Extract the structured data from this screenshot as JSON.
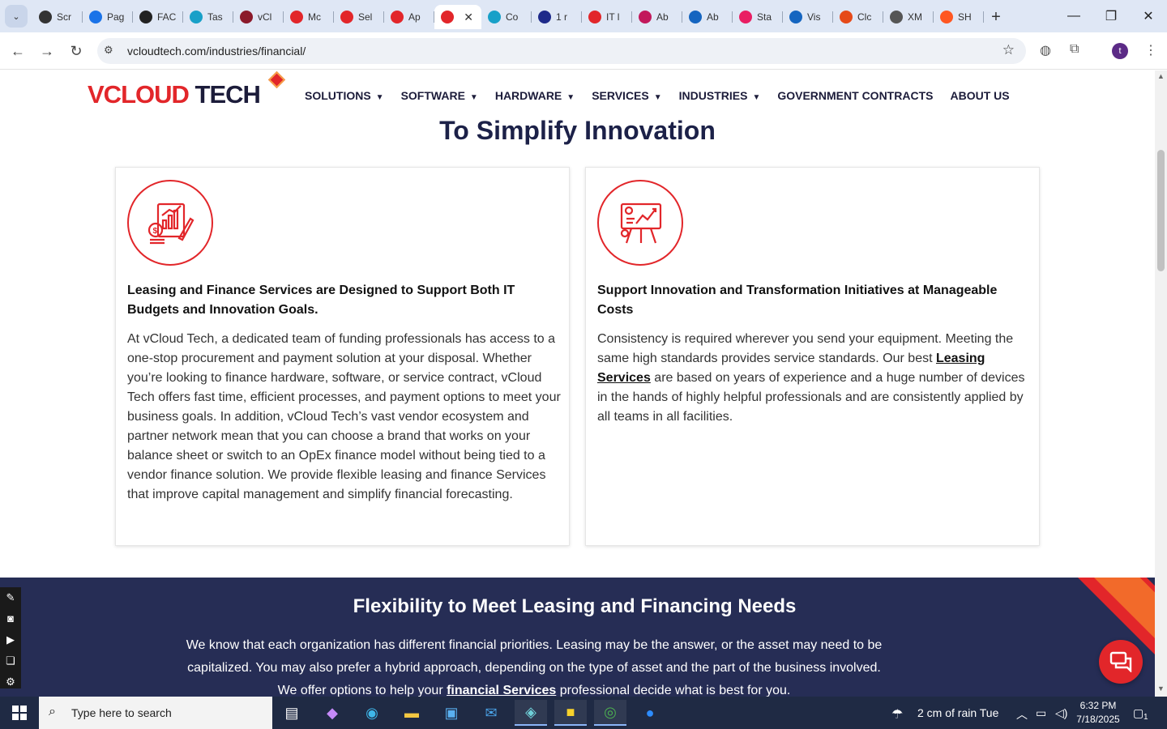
{
  "browser": {
    "tabs": [
      {
        "label": "Scr",
        "color": "#333333"
      },
      {
        "label": "Pag",
        "color": "#1a73e8"
      },
      {
        "label": "FAC",
        "color": "#222222"
      },
      {
        "label": "Tas",
        "color": "#18a0c8"
      },
      {
        "label": "vCl",
        "color": "#8b1a2b"
      },
      {
        "label": "Mc",
        "color": "#e2262a"
      },
      {
        "label": "Sel",
        "color": "#e2262a"
      },
      {
        "label": "Ap",
        "color": "#e2262a"
      },
      {
        "label": "",
        "color": "#e2262a"
      },
      {
        "label": "Co",
        "color": "#18a0c8"
      },
      {
        "label": "1 r",
        "color": "#1e2a8a"
      },
      {
        "label": "IT l",
        "color": "#e2262a"
      },
      {
        "label": "Ab",
        "color": "#c2185b"
      },
      {
        "label": "Ab",
        "color": "#1565c0"
      },
      {
        "label": "Sta",
        "color": "#e91e63"
      },
      {
        "label": "Vis",
        "color": "#1565c0"
      },
      {
        "label": "Clc",
        "color": "#e64a19"
      },
      {
        "label": "XM",
        "color": "#555555"
      },
      {
        "label": "SH",
        "color": "#ff5722"
      }
    ],
    "url": "vcloudtech.com/industries/financial/",
    "profile_initial": "t"
  },
  "site": {
    "logo_main": "VCLOUD",
    "logo_tech": "TECH",
    "nav": [
      {
        "label": "SOLUTIONS",
        "caret": "▼"
      },
      {
        "label": "SOFTWARE",
        "caret": "▼"
      },
      {
        "label": "HARDWARE",
        "caret": "▼"
      },
      {
        "label": "SERVICES",
        "caret": "▼"
      },
      {
        "label": "INDUSTRIES",
        "caret": "▼"
      },
      {
        "label": "GOVERNMENT CONTRACTS",
        "caret": ""
      },
      {
        "label": "ABOUT US",
        "caret": ""
      }
    ]
  },
  "section": {
    "title": "To Simplify Innovation"
  },
  "cards": [
    {
      "heading": "Leasing and Finance Services are Designed to Support Both IT Budgets and Innovation Goals.",
      "body": "At vCloud Tech, a dedicated team of funding professionals has access to a one-stop procurement and payment solution at your disposal. Whether you’re looking to finance hardware, software, or service contract, vCloud Tech offers fast time, efficient processes, and payment options to meet your business goals. In addition, vCloud Tech’s vast vendor ecosystem and partner network mean that you can choose a brand that works on your balance sheet or switch to an OpEx finance model without being tied to a vendor finance solution. We provide flexible leasing and finance Services that improve capital management and simplify financial forecasting."
    },
    {
      "heading": "Support Innovation and Transformation Initiatives at Manageable Costs",
      "body_before": "Consistency is required wherever you send your equipment. Meeting the same high standards provides service standards. Our best ",
      "body_link": "Leasing Services",
      "body_after": " are based on years of experience and a huge number of devices in the hands of highly helpful professionals and are consistently applied by all teams in all facilities."
    }
  ],
  "flex_section": {
    "title": "Flexibility to Meet Leasing and Financing Needs",
    "text_before": "We know that each organization has different financial priorities. Leasing may be the answer, or the asset may need to be capitalized. You may also prefer a hybrid approach, depending on the type of asset and the part of the business involved. We offer options to help your ",
    "text_link": "financial Services",
    "text_after": " professional decide what is best for you."
  },
  "taskbar": {
    "search_placeholder": "Type here to search",
    "weather": "2 cm of rain Tue",
    "time": "6:32 PM",
    "date": "7/18/2025",
    "notification_count": "1"
  },
  "colors": {
    "brand_red": "#e2262a",
    "navy": "#1c2148",
    "dark_section": "#262d55"
  }
}
